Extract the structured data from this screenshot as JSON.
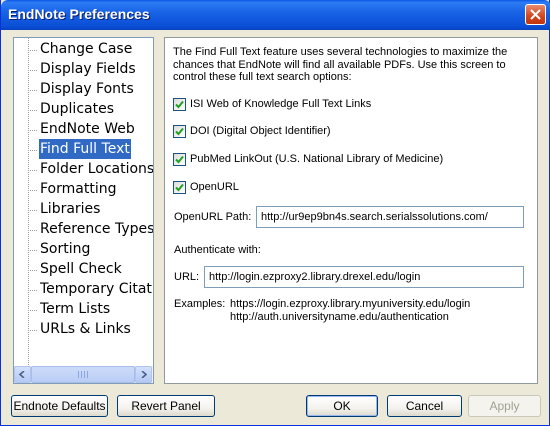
{
  "window": {
    "title": "EndNote Preferences"
  },
  "nav": {
    "items": [
      {
        "label": "Change Case"
      },
      {
        "label": "Display Fields"
      },
      {
        "label": "Display Fonts"
      },
      {
        "label": "Duplicates"
      },
      {
        "label": "EndNote Web"
      },
      {
        "label": "Find Full Text"
      },
      {
        "label": "Folder Locations"
      },
      {
        "label": "Formatting"
      },
      {
        "label": "Libraries"
      },
      {
        "label": "Reference Types"
      },
      {
        "label": "Sorting"
      },
      {
        "label": "Spell Check"
      },
      {
        "label": "Temporary Citatio"
      },
      {
        "label": "Term Lists"
      },
      {
        "label": "URLs & Links"
      }
    ],
    "selected": "Find Full Text"
  },
  "panel": {
    "intro": "The Find Full Text feature uses several technologies to maximize the chances that EndNote will find all available PDFs. Use this screen to control these full text search options:",
    "options": [
      {
        "label": "ISI Web of Knowledge Full Text Links",
        "checked": true
      },
      {
        "label": "DOI (Digital Object Identifier)",
        "checked": true
      },
      {
        "label": "PubMed LinkOut (U.S. National Library of Medicine)",
        "checked": true
      },
      {
        "label": "OpenURL",
        "checked": true
      }
    ],
    "openurl_path_label": "OpenURL Path:",
    "openurl_path_value": "http://ur9ep9bn4s.search.serialssolutions.com/",
    "authenticate_label": "Authenticate with:",
    "url_label": "URL:",
    "url_value": "http://login.ezproxy2.library.drexel.edu/login",
    "examples_label": "Examples:",
    "example_1": "https://login.ezproxy.library.myuniversity.edu/login",
    "example_2": "http://auth.universityname.edu/authentication"
  },
  "buttons": {
    "defaults": "Endnote Defaults",
    "revert": "Revert Panel",
    "ok": "OK",
    "cancel": "Cancel",
    "apply": "Apply"
  },
  "colors": {
    "selection": "#316ac5",
    "titlebar": "#0a58e4",
    "face": "#ece9d8"
  }
}
